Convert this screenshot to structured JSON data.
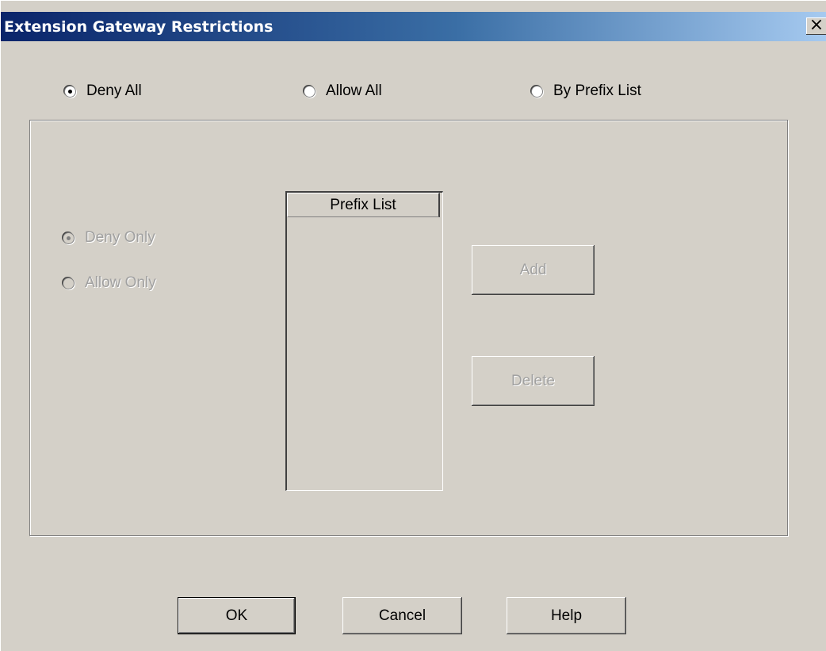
{
  "window": {
    "title": "Extension Gateway Restrictions",
    "close_glyph": "×",
    "close_icon": "close-icon"
  },
  "mode": {
    "options": [
      {
        "label": "Deny All",
        "checked": true
      },
      {
        "label": "Allow All",
        "checked": false
      },
      {
        "label": "By Prefix List",
        "checked": false
      }
    ]
  },
  "prefix_mode": {
    "options": [
      {
        "label": "Deny Only",
        "checked": true,
        "enabled": false
      },
      {
        "label": "Allow Only",
        "checked": false,
        "enabled": false
      }
    ]
  },
  "prefix_list": {
    "header": "Prefix List",
    "items": []
  },
  "list_buttons": {
    "add_label": "Add",
    "delete_label": "Delete"
  },
  "footer": {
    "ok_label": "OK",
    "cancel_label": "Cancel",
    "help_label": "Help"
  }
}
